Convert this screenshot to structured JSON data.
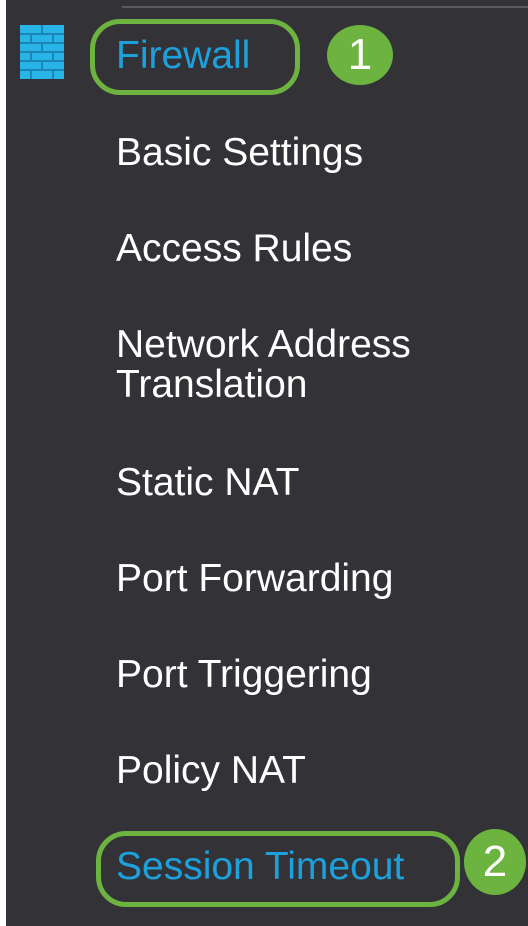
{
  "sidebar": {
    "section": {
      "icon": "firewall-icon",
      "label": "Firewall"
    },
    "items": [
      {
        "label": "Basic Settings"
      },
      {
        "label": "Access Rules"
      },
      {
        "label": "Network Address Translation"
      },
      {
        "label": "Static NAT"
      },
      {
        "label": "Port Forwarding"
      },
      {
        "label": "Port Triggering"
      },
      {
        "label": "Policy NAT"
      },
      {
        "label": "Session Timeout"
      }
    ]
  },
  "annotations": {
    "step1": "1",
    "step2": "2"
  },
  "colors": {
    "panel_background": "#333337",
    "active_text": "#1da1dc",
    "highlight_green": "#6db33f",
    "text": "#ffffff"
  }
}
